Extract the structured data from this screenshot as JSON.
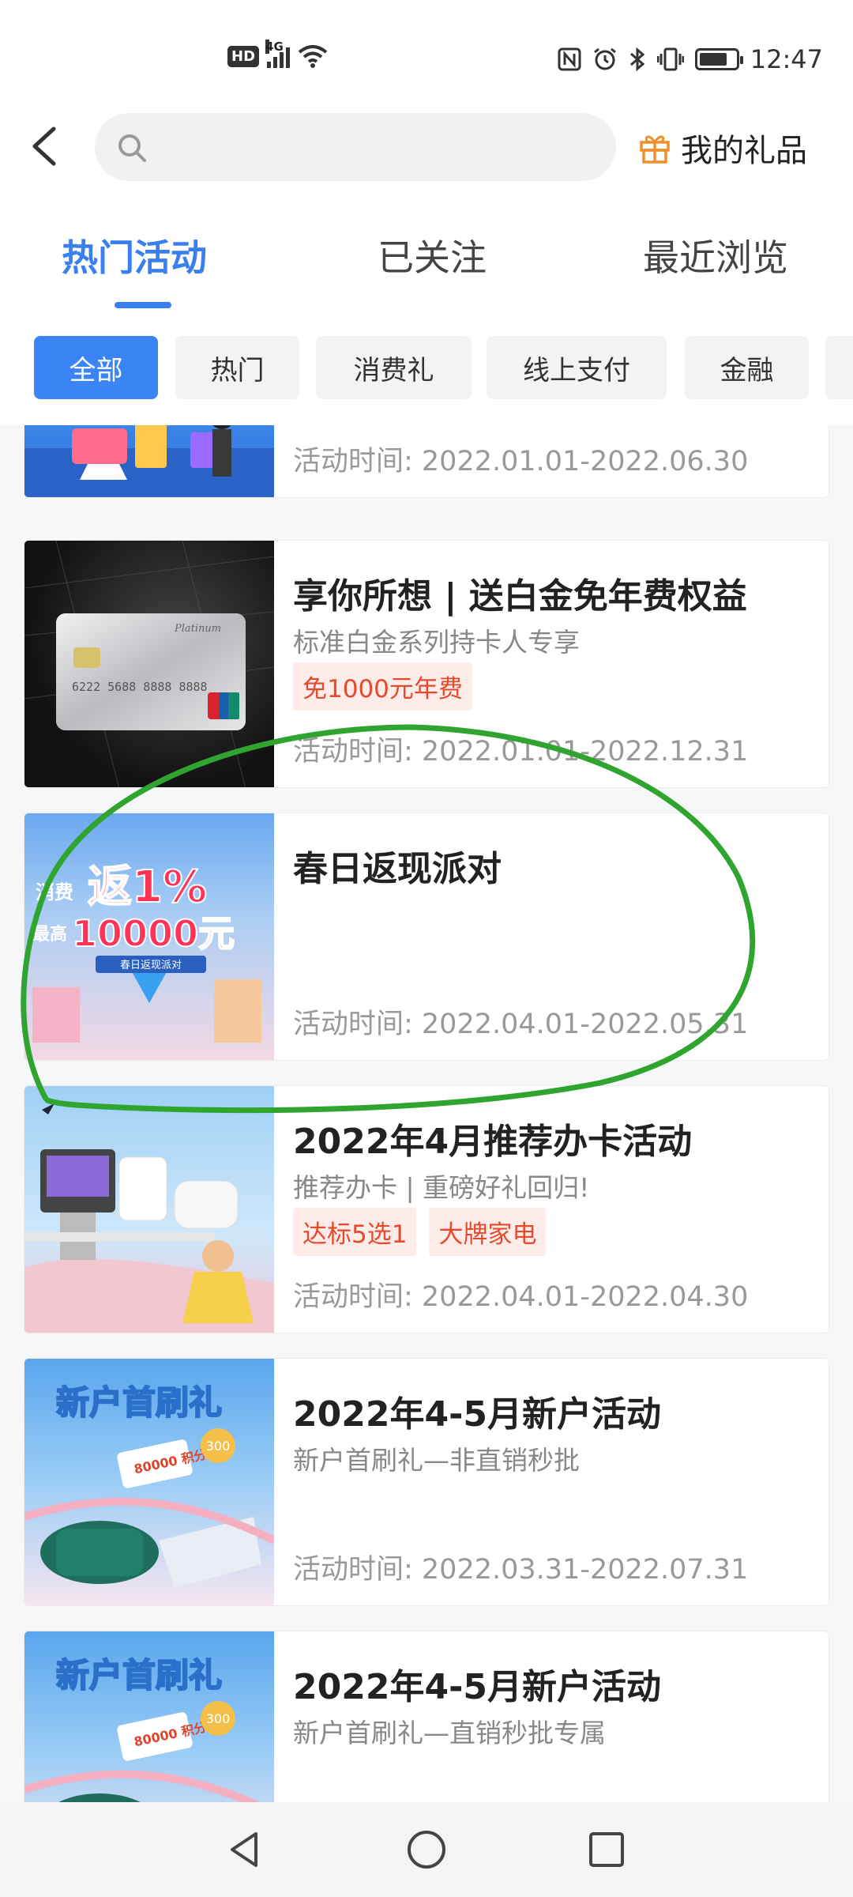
{
  "status_bar": {
    "hd": "HD",
    "network": "4G",
    "time": "12:47",
    "icons": [
      "nfc-icon",
      "alarm-icon",
      "bluetooth-icon",
      "vibrate-icon",
      "battery-icon"
    ]
  },
  "topbar": {
    "search_placeholder": "",
    "gift_label": "我的礼品"
  },
  "tabs": [
    {
      "label": "热门活动",
      "active": true
    },
    {
      "label": "已关注",
      "active": false
    },
    {
      "label": "最近浏览",
      "active": false
    }
  ],
  "chips": [
    {
      "label": "全部",
      "active": true
    },
    {
      "label": "热门",
      "active": false
    },
    {
      "label": "消费礼",
      "active": false
    },
    {
      "label": "线上支付",
      "active": false
    },
    {
      "label": "金融",
      "active": false
    }
  ],
  "cards": [
    {
      "title": "",
      "subtitle": "",
      "tags": [],
      "time": "活动时间: 2022.01.01-2022.06.30"
    },
    {
      "title": "享你所想 | 送白金免年费权益",
      "subtitle": "标准白金系列持卡人专享",
      "tags": [
        "免1000元年费"
      ],
      "time": "活动时间: 2022.01.01-2022.12.31",
      "thumb_text": {
        "card_number": "6222 5688 8888 8888",
        "brand": "UnionPay 银联",
        "series": "Platinum"
      }
    },
    {
      "title": "春日返现派对",
      "subtitle": "",
      "tags": [],
      "time": "活动时间: 2022.04.01-2022.05.31",
      "thumb_text": {
        "line1_small": "消费",
        "line1_big": "返1%",
        "line2_small": "最高",
        "line2_big": "10000元",
        "ribbon": "春日返现派对"
      }
    },
    {
      "title": "2022年4月推荐办卡活动",
      "subtitle": "推荐办卡 | 重磅好礼回归!",
      "tags": [
        "达标5选1",
        "大牌家电"
      ],
      "time": "活动时间: 2022.04.01-2022.04.30"
    },
    {
      "title": "2022年4-5月新户活动",
      "subtitle": "新户首刷礼—非直销秒批",
      "tags": [],
      "time": "活动时间: 2022.03.31-2022.07.31",
      "thumb_text": {
        "headline": "新户首刷礼",
        "points": "80000 积分",
        "coupon": "300"
      }
    },
    {
      "title": "2022年4-5月新户活动",
      "subtitle": "新户首刷礼—直销秒批专属",
      "tags": [],
      "time": "",
      "thumb_text": {
        "headline": "新户首刷礼",
        "points": "80000 积分",
        "coupon": "300"
      }
    }
  ],
  "colors": {
    "accent": "#3a7ff0",
    "chip_active": "#3a84f5",
    "tag_bg": "#fdece8",
    "tag_text": "#e64a2e",
    "annotation": "#2fa52f"
  }
}
